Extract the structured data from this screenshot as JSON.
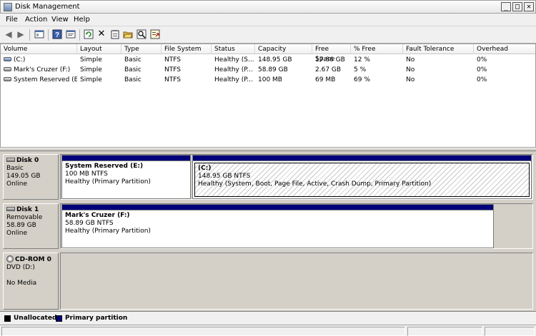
{
  "window": {
    "title": "Disk Management"
  },
  "menu": [
    "File",
    "Action",
    "View",
    "Help"
  ],
  "toolbar": {
    "icons": [
      "back-icon",
      "forward-icon",
      "console-icon",
      "help-icon",
      "properties-icon",
      "refresh-icon",
      "delete-icon",
      "properties-sheet-icon",
      "open-icon",
      "search-icon",
      "export-icon"
    ]
  },
  "volumes": {
    "columns": [
      "Volume",
      "Layout",
      "Type",
      "File System",
      "Status",
      "Capacity",
      "Free Space",
      "% Free",
      "Fault Tolerance",
      "Overhead"
    ],
    "rows": [
      {
        "volume": "(C:)",
        "layout": "Simple",
        "type": "Basic",
        "fs": "NTFS",
        "status": "Healthy (S...",
        "capacity": "148.95 GB",
        "free": "17.86 GB",
        "pct": "12 %",
        "fault": "No",
        "overhead": "0%"
      },
      {
        "volume": "Mark's Cruzer (F:)",
        "layout": "Simple",
        "type": "Basic",
        "fs": "NTFS",
        "status": "Healthy (P...",
        "capacity": "58.89 GB",
        "free": "2.67 GB",
        "pct": "5 %",
        "fault": "No",
        "overhead": "0%"
      },
      {
        "volume": "System Reserved (E:)",
        "layout": "Simple",
        "type": "Basic",
        "fs": "NTFS",
        "status": "Healthy (P...",
        "capacity": "100 MB",
        "free": "69 MB",
        "pct": "69 %",
        "fault": "No",
        "overhead": "0%"
      }
    ]
  },
  "disks": [
    {
      "name": "Disk 0",
      "kind": "Basic",
      "size": "149.05 GB",
      "state": "Online",
      "partitions": [
        {
          "name": "System Reserved  (E:)",
          "size": "100 MB NTFS",
          "status": "Healthy (Primary Partition)"
        },
        {
          "name": "(C:)",
          "size": "148.95 GB NTFS",
          "status": "Healthy (System, Boot, Page File, Active, Crash Dump, Primary Partition)"
        }
      ]
    },
    {
      "name": "Disk 1",
      "kind": "Removable",
      "size": "58.89 GB",
      "state": "Online",
      "partitions": [
        {
          "name": "Mark's Cruzer  (F:)",
          "size": "58.89 GB NTFS",
          "status": "Healthy (Primary Partition)"
        }
      ]
    },
    {
      "name": "CD-ROM 0",
      "kind": "DVD (D:)",
      "size": "",
      "state": "No Media",
      "partitions": []
    }
  ],
  "legend": [
    {
      "label": "Unallocated",
      "color": "#000000"
    },
    {
      "label": "Primary partition",
      "color": "#00007a"
    }
  ]
}
